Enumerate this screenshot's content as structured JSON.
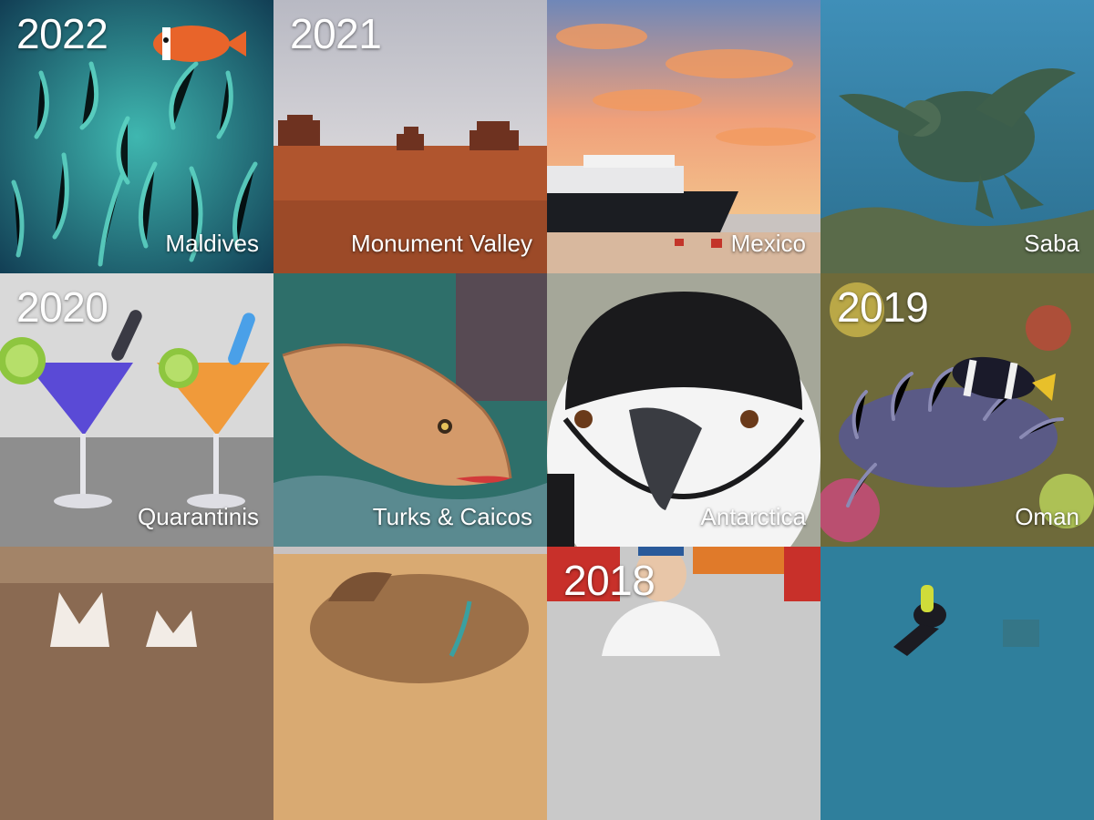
{
  "tiles": [
    {
      "year": "2022",
      "label": "Maldives",
      "image": "clownfish-anemone"
    },
    {
      "year": "2021",
      "label": "Monument Valley",
      "image": "desert-buttes"
    },
    {
      "year": "",
      "label": "Mexico",
      "image": "expedition-ship-sunset"
    },
    {
      "year": "",
      "label": "Saba",
      "image": "sea-turtle"
    },
    {
      "year": "2020",
      "label": "Quarantinis",
      "image": "martini-glasses-thermometers"
    },
    {
      "year": "",
      "label": "Turks & Caicos",
      "image": "grouper-fish"
    },
    {
      "year": "",
      "label": "Antarctica",
      "image": "chinstrap-penguin"
    },
    {
      "year": "2019",
      "label": "Oman",
      "image": "clownfish-pair"
    },
    {
      "year": "",
      "label": "",
      "image": "husky-puppies"
    },
    {
      "year": "",
      "label": "",
      "image": "camel"
    },
    {
      "year": "2018",
      "label": "",
      "image": "fencer"
    },
    {
      "year": "",
      "label": "",
      "image": "scuba-diver"
    }
  ]
}
